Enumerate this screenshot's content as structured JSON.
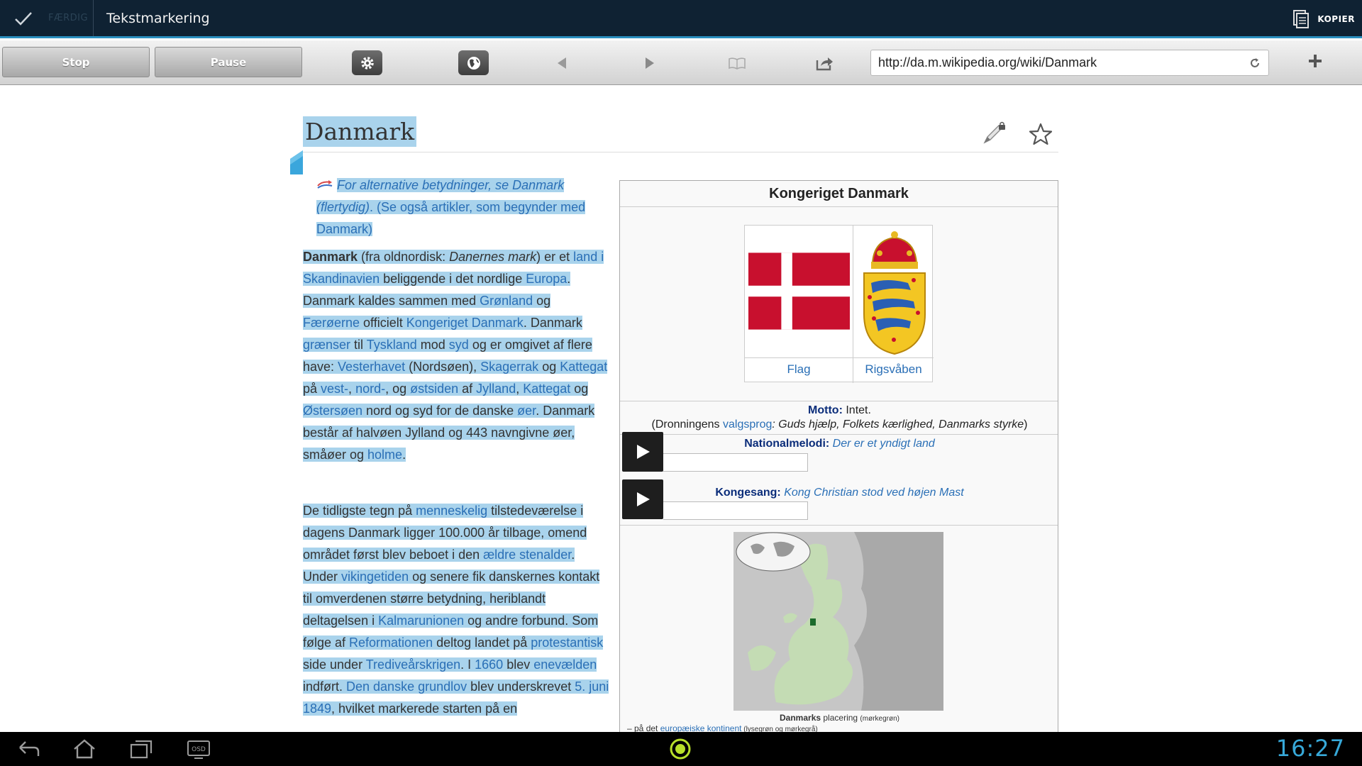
{
  "actionbar": {
    "done_label": "FÆRDIG",
    "title": "Tekstmarkering",
    "copy_label": "KOPIER"
  },
  "toolbar": {
    "stop_label": "Stop",
    "pause_label": "Pause",
    "url": "http://da.m.wikipedia.org/wiki/Danmark"
  },
  "article": {
    "title": "Danmark",
    "disambig": {
      "italic": "For alternative betydninger, se",
      "link1": "Danmark",
      "link2": "(flertydig)",
      "rest": ". (Se også artikler, som begynder med",
      "link3": "Danmark",
      "close": ")"
    },
    "p1": [
      {
        "t": "Danmark",
        "k": "b"
      },
      {
        "t": " (fra oldnordisk: ",
        "k": "n"
      },
      {
        "t": "Danernes mark",
        "k": "i"
      },
      {
        "t": ") er et ",
        "k": "n"
      },
      {
        "t": "land",
        "k": "a"
      },
      {
        "t": " ",
        "k": "n"
      },
      {
        "t": "i",
        "k": "a"
      },
      {
        "t": " ",
        "k": "n"
      },
      {
        "t": "Skandinavien",
        "k": "a"
      },
      {
        "t": " beliggende i det nordlige ",
        "k": "n"
      },
      {
        "t": "Europa",
        "k": "a"
      },
      {
        "t": ". Danmark kaldes sammen med ",
        "k": "n"
      },
      {
        "t": "Grønland",
        "k": "a"
      },
      {
        "t": " og ",
        "k": "n"
      },
      {
        "t": "Færøerne",
        "k": "a"
      },
      {
        "t": " officielt ",
        "k": "n"
      },
      {
        "t": "Kongeriget Danmark",
        "k": "a"
      },
      {
        "t": ". Danmark ",
        "k": "n"
      },
      {
        "t": "grænser",
        "k": "a"
      },
      {
        "t": " til ",
        "k": "n"
      },
      {
        "t": "Tyskland",
        "k": "a"
      },
      {
        "t": " mod ",
        "k": "n"
      },
      {
        "t": "syd",
        "k": "a"
      },
      {
        "t": " og er omgivet af flere have: ",
        "k": "n"
      },
      {
        "t": "Vesterhavet",
        "k": "a"
      },
      {
        "t": " (Nordsøen), ",
        "k": "n"
      },
      {
        "t": "Skagerrak",
        "k": "a"
      },
      {
        "t": " og ",
        "k": "n"
      },
      {
        "t": "Kattegat",
        "k": "a"
      },
      {
        "t": " på ",
        "k": "n"
      },
      {
        "t": "vest-",
        "k": "a"
      },
      {
        "t": ", ",
        "k": "n"
      },
      {
        "t": "nord-",
        "k": "a"
      },
      {
        "t": ", og ",
        "k": "n"
      },
      {
        "t": "østsiden",
        "k": "a"
      },
      {
        "t": " af ",
        "k": "n"
      },
      {
        "t": "Jylland",
        "k": "a"
      },
      {
        "t": ", ",
        "k": "n"
      },
      {
        "t": "Kattegat",
        "k": "a"
      },
      {
        "t": " og ",
        "k": "n"
      },
      {
        "t": "Østersøen",
        "k": "a"
      },
      {
        "t": " nord og syd for de danske ",
        "k": "n"
      },
      {
        "t": "øer",
        "k": "a"
      },
      {
        "t": ". Danmark består af halvøen Jylland og 443 navngivne øer, småøer og ",
        "k": "n"
      },
      {
        "t": "holme",
        "k": "a"
      },
      {
        "t": ".",
        "k": "n"
      }
    ],
    "p2": [
      {
        "t": "De tidligste tegn på ",
        "k": "n"
      },
      {
        "t": "menneskelig",
        "k": "a"
      },
      {
        "t": " tilstedeværelse i dagens Danmark ligger 100.000 år tilbage, omend området først blev beboet i den ",
        "k": "n"
      },
      {
        "t": "ældre stenalder",
        "k": "a"
      },
      {
        "t": ". Under ",
        "k": "n"
      },
      {
        "t": "vikingetiden",
        "k": "a"
      },
      {
        "t": " og senere fik danskernes kontakt til omverdenen større betydning, heriblandt deltagelsen i ",
        "k": "n"
      },
      {
        "t": "Kalmarunionen",
        "k": "a"
      },
      {
        "t": " og andre forbund. Som følge af ",
        "k": "n"
      },
      {
        "t": "Reformationen",
        "k": "a"
      },
      {
        "t": " deltog landet på ",
        "k": "n"
      },
      {
        "t": "protestantisk",
        "k": "a"
      },
      {
        "t": " side under ",
        "k": "n"
      },
      {
        "t": "Trediveårskrigen",
        "k": "a"
      },
      {
        "t": ". I ",
        "k": "n"
      },
      {
        "t": "1660",
        "k": "a"
      },
      {
        "t": " blev ",
        "k": "n"
      },
      {
        "t": "enevælden",
        "k": "a"
      },
      {
        "t": " indført. ",
        "k": "n"
      },
      {
        "t": "Den danske grundlov",
        "k": "a"
      },
      {
        "t": " blev underskrevet ",
        "k": "n"
      },
      {
        "t": "5. juni",
        "k": "a"
      },
      {
        "t": " ",
        "k": "n"
      },
      {
        "t": "1849",
        "k": "a"
      },
      {
        "t": ", hvilket markerede starten på en",
        "k": "n"
      }
    ]
  },
  "infobox": {
    "title": "Kongeriget Danmark",
    "flag_caption": "Flag",
    "coa_caption": "Rigsvåben",
    "motto_label": "Motto:",
    "motto_value": " Intet.",
    "motto_line2_pre": "(Dronningens ",
    "motto_line2_link": "valgsprog",
    "motto_line2_italic": ": Guds hjælp, Folkets kærlighed, Danmarks styrke",
    "motto_line2_post": ")",
    "anthem_label": "Nationalmelodi:",
    "anthem_value": " Der er et yndigt land",
    "royal_label": "Kongesang:",
    "royal_value": " Kong Christian stod ved højen Mast",
    "map_caption_bold": "Danmarks",
    "map_caption_rest": " placering ",
    "map_caption_small": "(mørkegrøn)",
    "map_caption2_pre": "– på det ",
    "map_caption2_link": "europæiske kontinent",
    "map_caption2_small": " (lysegrøn og mørkegrå)"
  },
  "system": {
    "clock": "16:27",
    "osd_label": "OSD"
  },
  "colors": {
    "actionbar_bg": "#0f2233",
    "accent": "#2a8fbf",
    "selection": "#a9d3ec",
    "link": "#2a6fb6",
    "clock": "#37a8d8"
  }
}
